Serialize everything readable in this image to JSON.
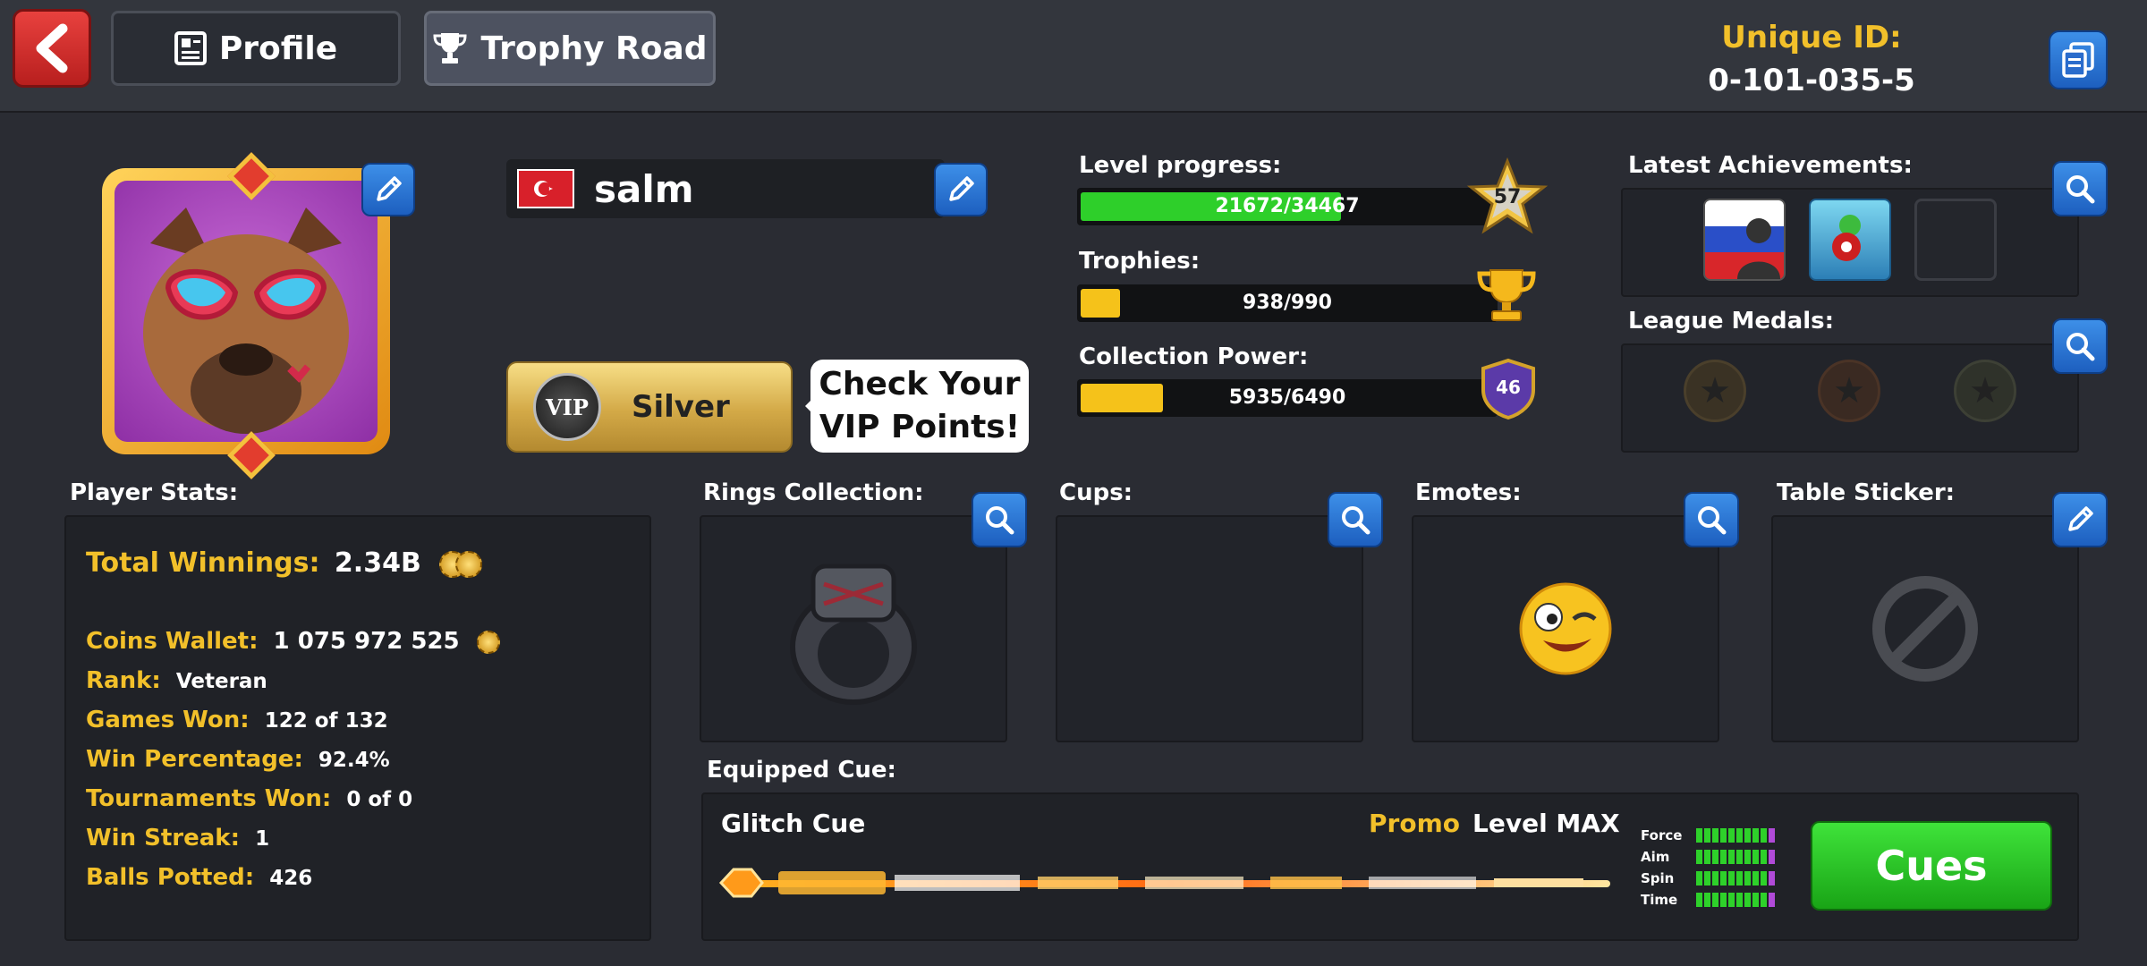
{
  "header": {
    "back_icon": "chevron-left-icon",
    "tabs": [
      {
        "label": "Profile",
        "icon": "profile-card-icon",
        "active": false
      },
      {
        "label": "Trophy Road",
        "icon": "trophy-icon",
        "active": true
      }
    ],
    "unique_id_label": "Unique ID:",
    "unique_id_value": "0-101-035-5",
    "copy_icon": "copy-icon"
  },
  "profile": {
    "player_name": "salm",
    "flag": "Turkey",
    "vip_tier": "Silver",
    "vip_badge_text": "VIP",
    "vip_bubble_line1": "Check Your",
    "vip_bubble_line2": "VIP Points!"
  },
  "level": {
    "label": "Level progress:",
    "text": "21672/34467",
    "fraction": 0.629,
    "badge": "57",
    "fill_color": "#2ecf2a"
  },
  "trophies": {
    "label": "Trophies:",
    "text": "938/990",
    "fraction": 0.095,
    "fill_color": "#f5c21a"
  },
  "collection_power": {
    "label": "Collection Power:",
    "text": "5935/6490",
    "fraction": 0.2,
    "badge": "46",
    "fill_color": "#f5c21a"
  },
  "achievements": {
    "label": "Latest Achievements:",
    "items": [
      "russia-flag-avatar",
      "pool-ball-achievement",
      "empty-slot"
    ]
  },
  "league": {
    "label": "League Medals:"
  },
  "stats": {
    "title": "Player Stats:",
    "total_winnings_key": "Total Winnings:",
    "total_winnings_val": "2.34B",
    "coins_wallet_key": "Coins Wallet:",
    "coins_wallet_val": "1 075 972 525",
    "rank_key": "Rank:",
    "rank_val": "Veteran",
    "games_won_key": "Games Won:",
    "games_won_val": "122 of 132",
    "win_pct_key": "Win Percentage:",
    "win_pct_val": "92.4%",
    "tournaments_key": "Tournaments Won:",
    "tournaments_val": "0 of 0",
    "streak_key": "Win Streak:",
    "streak_val": "1",
    "balls_key": "Balls Potted:",
    "balls_val": "426"
  },
  "collections": {
    "rings": "Rings Collection:",
    "cups": "Cups:",
    "emotes": "Emotes:",
    "sticker": "Table Sticker:"
  },
  "cue": {
    "section_title": "Equipped Cue:",
    "name": "Glitch Cue",
    "tag": "Promo",
    "level": "Level MAX",
    "stat_labels": [
      "Force",
      "Aim",
      "Spin",
      "Time"
    ],
    "button_label": "Cues"
  },
  "colors": {
    "accent_yellow": "#f2c02a",
    "button_blue": "#2a75d6",
    "button_green": "#2ed12a",
    "back_red": "#d8302e"
  }
}
